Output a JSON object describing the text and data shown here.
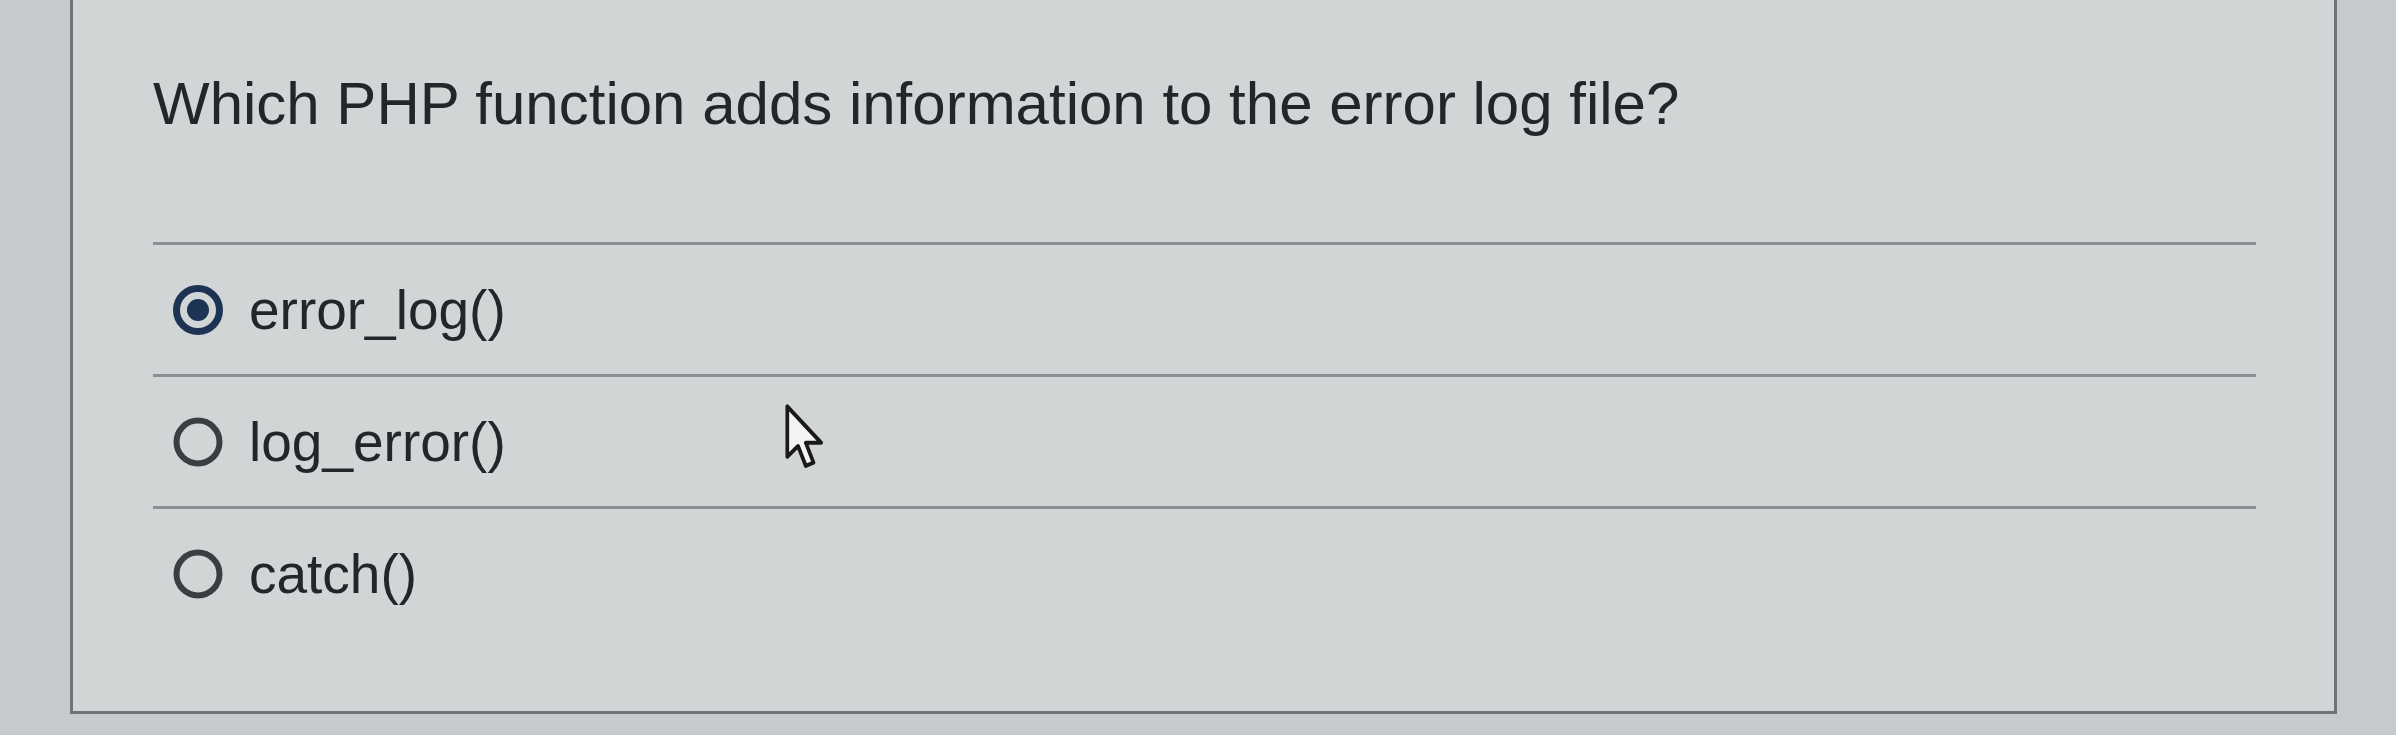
{
  "question": {
    "text": "Which PHP function adds information to the error log file?"
  },
  "options": [
    {
      "label": "error_log()",
      "selected": true
    },
    {
      "label": "log_error()",
      "selected": false
    },
    {
      "label": "catch()",
      "selected": false
    }
  ]
}
